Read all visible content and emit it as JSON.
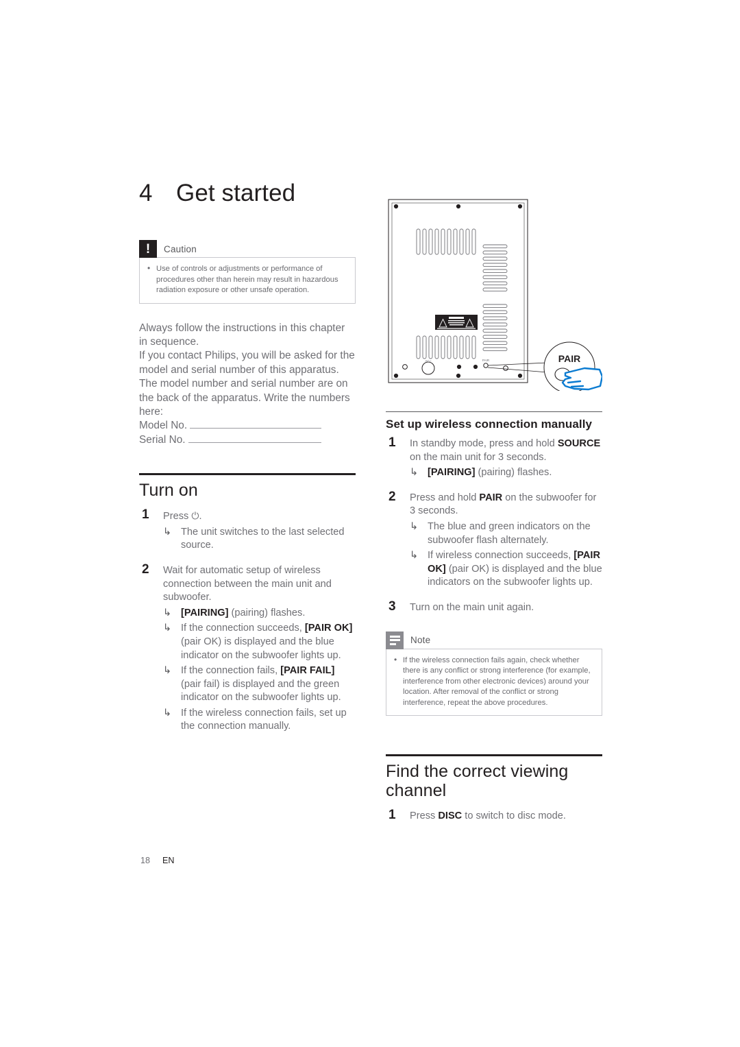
{
  "page": {
    "footer_page_number": "18",
    "footer_language": "EN"
  },
  "chapter": {
    "number": "4",
    "title": "Get started"
  },
  "caution": {
    "icon": "caution-icon",
    "label": "Caution",
    "items": [
      "Use of controls or adjustments or performance of procedures other than herein may result in hazardous radiation exposure or other unsafe operation."
    ]
  },
  "intro": {
    "paragraph_1": "Always follow the instructions in this chapter in sequence.",
    "paragraph_2": "If you contact Philips, you will be asked for the model and serial number of this apparatus. The model number and serial number are on the back of the apparatus. Write the numbers here:",
    "model_label": "Model No.",
    "serial_label": "Serial No."
  },
  "turn_on": {
    "heading": "Turn on",
    "steps": [
      {
        "text_before": "Press ",
        "power_symbol": "⏻",
        "text_after": ".",
        "arrows": [
          "The unit switches to the last selected source."
        ]
      },
      {
        "text": "Wait for automatic setup of wireless connection between the main unit and subwoofer.",
        "arrows": [
          {
            "bold": "[PAIRING]",
            "rest": " (pairing) flashes."
          },
          {
            "lead": "If the connection succeeds, ",
            "bold": "[PAIR OK]",
            "rest": " (pair OK) is displayed and the blue indicator on the subwoofer lights up."
          },
          {
            "lead": "If the connection fails, ",
            "bold": "[PAIR FAIL]",
            "rest": " (pair fail) is displayed and the green indicator on the subwoofer lights up."
          },
          {
            "lead": "If the wireless connection fails, set up the connection manually.",
            "bold": "",
            "rest": ""
          }
        ]
      }
    ]
  },
  "illustration": {
    "name": "subwoofer-rear-panel-diagram",
    "callout_label": "PAIR",
    "panel_port_label": "AC~",
    "panel_button_label": "PAIR",
    "caution_plate_title": "CAUTION"
  },
  "wireless_manual": {
    "heading": "Set up wireless connection manually",
    "steps": [
      {
        "lead": "In standby mode, press and hold ",
        "bold": "SOURCE",
        "rest": " on the main unit for 3 seconds.",
        "arrows": [
          {
            "lead": "",
            "bold": "[PAIRING]",
            "rest": " (pairing) flashes."
          }
        ]
      },
      {
        "lead": "Press and hold ",
        "bold": "PAIR",
        "rest": " on the subwoofer for 3 seconds.",
        "arrows": [
          {
            "lead": "The blue and green indicators on the subwoofer flash alternately.",
            "bold": "",
            "rest": ""
          },
          {
            "lead": "If wireless connection succeeds, ",
            "bold": "[PAIR OK]",
            "rest": " (pair OK) is displayed and the blue indicators on the subwoofer lights up."
          }
        ]
      },
      {
        "lead": "Turn on the main unit again.",
        "bold": "",
        "rest": "",
        "arrows": []
      }
    ]
  },
  "note": {
    "icon": "note-icon",
    "label": "Note",
    "items": [
      "If the wireless connection fails again, check whether there is any conflict or strong interference (for example, interference from other electronic devices) around your location. After removal of the conflict or strong interference, repeat the above procedures."
    ]
  },
  "viewing_channel": {
    "heading": "Find the correct viewing channel",
    "steps": [
      {
        "lead": "Press ",
        "bold": "DISC",
        "rest": " to switch to disc mode."
      }
    ]
  }
}
